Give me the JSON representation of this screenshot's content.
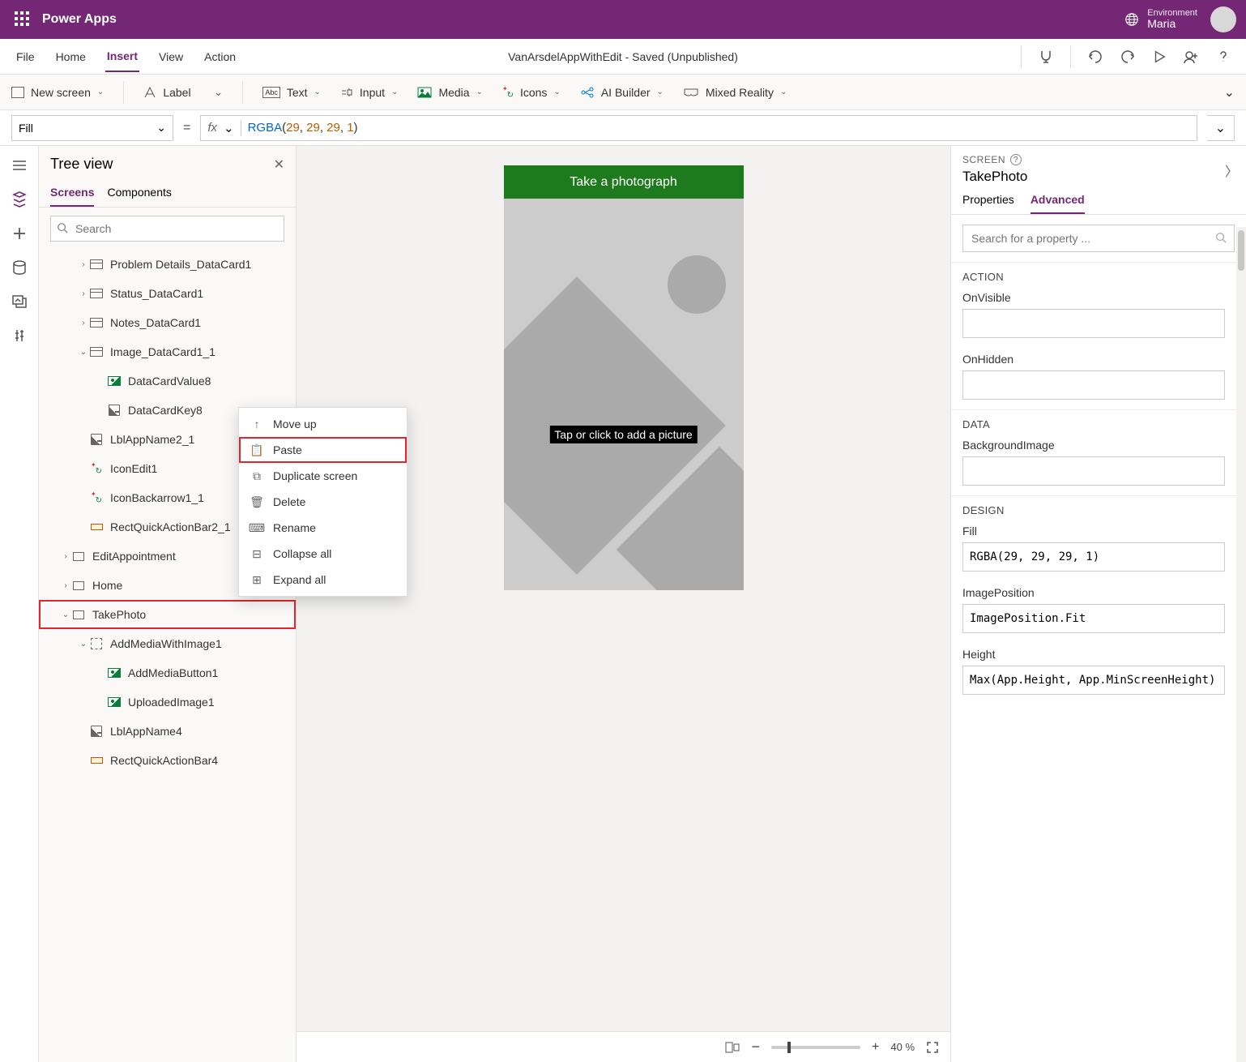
{
  "header": {
    "app_title": "Power Apps",
    "env_label": "Environment",
    "env_name": "Maria"
  },
  "menu": {
    "items": [
      "File",
      "Home",
      "Insert",
      "View",
      "Action"
    ],
    "active_index": 2,
    "doc_status": "VanArsdelAppWithEdit - Saved (Unpublished)"
  },
  "ribbon": {
    "new_screen": "New screen",
    "label": "Label",
    "text": "Text",
    "input": "Input",
    "media": "Media",
    "icons": "Icons",
    "ai_builder": "AI Builder",
    "mixed_reality": "Mixed Reality"
  },
  "formula": {
    "property": "Fill",
    "fn": "RGBA",
    "args": [
      "29",
      "29",
      "29",
      "1"
    ]
  },
  "tree": {
    "title": "Tree view",
    "tabs": [
      "Screens",
      "Components"
    ],
    "active_tab": 0,
    "search_placeholder": "Search",
    "items": [
      {
        "label": "Problem Details_DataCard1",
        "indent": 2,
        "chev": "right",
        "icon": "card"
      },
      {
        "label": "Status_DataCard1",
        "indent": 2,
        "chev": "right",
        "icon": "card"
      },
      {
        "label": "Notes_DataCard1",
        "indent": 2,
        "chev": "right",
        "icon": "card"
      },
      {
        "label": "Image_DataCard1_1",
        "indent": 2,
        "chev": "down",
        "icon": "card"
      },
      {
        "label": "DataCardValue8",
        "indent": 3,
        "chev": "",
        "icon": "img"
      },
      {
        "label": "DataCardKey8",
        "indent": 3,
        "chev": "",
        "icon": "edit"
      },
      {
        "label": "LblAppName2_1",
        "indent": 2,
        "chev": "",
        "icon": "edit"
      },
      {
        "label": "IconEdit1",
        "indent": 2,
        "chev": "",
        "icon": "iconset"
      },
      {
        "label": "IconBackarrow1_1",
        "indent": 2,
        "chev": "",
        "icon": "iconset"
      },
      {
        "label": "RectQuickActionBar2_1",
        "indent": 2,
        "chev": "",
        "icon": "rect"
      },
      {
        "label": "EditAppointment",
        "indent": 1,
        "chev": "right",
        "icon": "screen"
      },
      {
        "label": "Home",
        "indent": 1,
        "chev": "right",
        "icon": "screen"
      },
      {
        "label": "TakePhoto",
        "indent": 1,
        "chev": "down",
        "icon": "screen",
        "highlight": true
      },
      {
        "label": "AddMediaWithImage1",
        "indent": 2,
        "chev": "down",
        "icon": "group"
      },
      {
        "label": "AddMediaButton1",
        "indent": 3,
        "chev": "",
        "icon": "img"
      },
      {
        "label": "UploadedImage1",
        "indent": 3,
        "chev": "",
        "icon": "img"
      },
      {
        "label": "LblAppName4",
        "indent": 2,
        "chev": "",
        "icon": "edit"
      },
      {
        "label": "RectQuickActionBar4",
        "indent": 2,
        "chev": "",
        "icon": "rect"
      }
    ]
  },
  "context_menu": {
    "items": [
      {
        "label": "Move up",
        "icon": "↑"
      },
      {
        "label": "Paste",
        "icon": "📋",
        "highlight": true
      },
      {
        "label": "Duplicate screen",
        "icon": "⧉"
      },
      {
        "label": "Delete",
        "icon": "🗑"
      },
      {
        "label": "Rename",
        "icon": "⌨"
      },
      {
        "label": "Collapse all",
        "icon": "⊟"
      },
      {
        "label": "Expand all",
        "icon": "⊞"
      }
    ]
  },
  "canvas": {
    "phone_title": "Take a photograph",
    "tap_label": "Tap or click to add a picture",
    "zoom_value": "40",
    "zoom_unit": "%"
  },
  "props": {
    "type_label": "SCREEN",
    "name": "TakePhoto",
    "tabs": [
      "Properties",
      "Advanced"
    ],
    "active_tab": 1,
    "search_placeholder": "Search for a property ...",
    "sections": {
      "action": {
        "title": "ACTION",
        "fields": [
          {
            "label": "OnVisible",
            "value": ""
          },
          {
            "label": "OnHidden",
            "value": ""
          }
        ]
      },
      "data": {
        "title": "DATA",
        "fields": [
          {
            "label": "BackgroundImage",
            "value": ""
          }
        ]
      },
      "design": {
        "title": "DESIGN",
        "fields": [
          {
            "label": "Fill",
            "value": "RGBA(29, 29, 29, 1)"
          },
          {
            "label": "ImagePosition",
            "value": "ImagePosition.Fit"
          },
          {
            "label": "Height",
            "value": "Max(App.Height, App.MinScreenHeight)"
          }
        ]
      }
    }
  }
}
